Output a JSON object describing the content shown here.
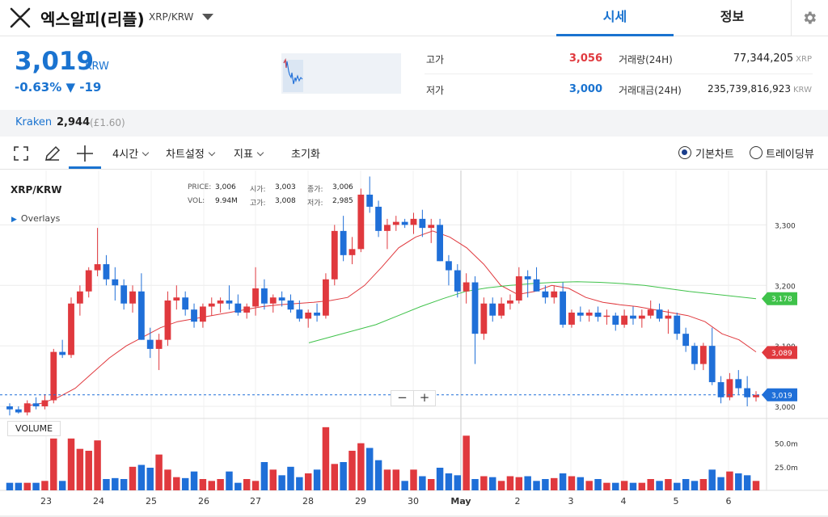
{
  "header": {
    "coin_name": "엑스알피(리플)",
    "pair": "XRP/KRW",
    "tabs": [
      {
        "label": "시세",
        "active": true
      },
      {
        "label": "정보",
        "active": false
      }
    ]
  },
  "price": {
    "current": "3,019",
    "unit": "KRW",
    "change_pct": "-0.63%",
    "change_abs": "▼ -19"
  },
  "stats": {
    "high_label": "고가",
    "high_value": "3,056",
    "low_label": "저가",
    "low_value": "3,000",
    "volume_label": "거래량(24H)",
    "volume_value": "77,344,205",
    "volume_unit": "XRP",
    "amount_label": "거래대금(24H)",
    "amount_value": "235,739,816,923",
    "amount_unit": "KRW"
  },
  "exchange": {
    "name": "Kraken",
    "price": "2,944",
    "sub": "(£1.60)"
  },
  "toolbar": {
    "interval": "4시간",
    "chart_settings": "차트설정",
    "indicators": "지표",
    "reset": "초기화",
    "radio_basic": "기본차트",
    "radio_tradingview": "트레이딩뷰"
  },
  "chart_info": {
    "symbol": "XRP/KRW",
    "overlays": "Overlays",
    "price_k": "PRICE:",
    "price_v": "3,006",
    "vol_k": "VOL:",
    "vol_v": "9.94M",
    "open_k": "시가:",
    "open_v": "3,003",
    "high_k": "고가:",
    "high_v": "3,008",
    "close_k": "종가:",
    "close_v": "3,006",
    "low_k": "저가:",
    "low_v": "2,985",
    "volume_label": "VOLUME",
    "zoom_out": "−",
    "zoom_in": "+"
  },
  "colors": {
    "accent": "#1a73d0",
    "up": "#e0393e",
    "down": "#1f6fd8",
    "ma_short": "#e0393e",
    "ma_long": "#3fc24a"
  },
  "chart_data": {
    "type": "candlestick",
    "price_axis": {
      "ticks": [
        "3,300",
        "3,200",
        "3,100",
        "3,000"
      ],
      "tick_values": [
        3300,
        3200,
        3100,
        3000
      ],
      "range": [
        2980,
        3390
      ]
    },
    "volume_axis": {
      "ticks": [
        "50.0m",
        "25.0m"
      ],
      "tick_values": [
        50,
        25
      ],
      "range": [
        0,
        72
      ]
    },
    "x_labels": [
      "23",
      "24",
      "25",
      "26",
      "27",
      "28",
      "29",
      "30",
      "May",
      "2",
      "3",
      "4",
      "5",
      "6"
    ],
    "last_price_tag": "3,019",
    "ma_tags": [
      "3,178",
      "3,089"
    ],
    "ohlc": [
      [
        3000,
        3005,
        2985,
        2995
      ],
      [
        2995,
        3000,
        2988,
        2990
      ],
      [
        2990,
        3010,
        2985,
        3005
      ],
      [
        3005,
        3015,
        2995,
        3000
      ],
      [
        3000,
        3020,
        2995,
        3010
      ],
      [
        3010,
        3095,
        3005,
        3090
      ],
      [
        3090,
        3110,
        3080,
        3085
      ],
      [
        3085,
        3180,
        3080,
        3170
      ],
      [
        3170,
        3200,
        3150,
        3190
      ],
      [
        3190,
        3230,
        3180,
        3225
      ],
      [
        3225,
        3295,
        3215,
        3235
      ],
      [
        3235,
        3250,
        3200,
        3210
      ],
      [
        3210,
        3230,
        3175,
        3200
      ],
      [
        3200,
        3210,
        3160,
        3170
      ],
      [
        3170,
        3200,
        3155,
        3190
      ],
      [
        3190,
        3220,
        3110,
        3110
      ],
      [
        3110,
        3130,
        3080,
        3095
      ],
      [
        3095,
        3120,
        3060,
        3110
      ],
      [
        3110,
        3190,
        3100,
        3175
      ],
      [
        3175,
        3200,
        3160,
        3180
      ],
      [
        3180,
        3190,
        3150,
        3160
      ],
      [
        3160,
        3170,
        3130,
        3140
      ],
      [
        3140,
        3170,
        3130,
        3165
      ],
      [
        3165,
        3180,
        3150,
        3170
      ],
      [
        3170,
        3180,
        3155,
        3175
      ],
      [
        3175,
        3200,
        3160,
        3170
      ],
      [
        3170,
        3185,
        3150,
        3155
      ],
      [
        3155,
        3170,
        3145,
        3165
      ],
      [
        3165,
        3230,
        3150,
        3195
      ],
      [
        3195,
        3210,
        3160,
        3170
      ],
      [
        3170,
        3185,
        3155,
        3180
      ],
      [
        3180,
        3190,
        3165,
        3175
      ],
      [
        3175,
        3185,
        3155,
        3160
      ],
      [
        3160,
        3175,
        3140,
        3145
      ],
      [
        3145,
        3160,
        3130,
        3155
      ],
      [
        3155,
        3170,
        3140,
        3150
      ],
      [
        3150,
        3220,
        3145,
        3210
      ],
      [
        3210,
        3300,
        3200,
        3290
      ],
      [
        3290,
        3315,
        3240,
        3250
      ],
      [
        3250,
        3280,
        3235,
        3260
      ],
      [
        3260,
        3360,
        3255,
        3350
      ],
      [
        3350,
        3380,
        3320,
        3330
      ],
      [
        3330,
        3340,
        3280,
        3290
      ],
      [
        3290,
        3310,
        3260,
        3300
      ],
      [
        3300,
        3315,
        3290,
        3305
      ],
      [
        3305,
        3310,
        3295,
        3300
      ],
      [
        3300,
        3320,
        3285,
        3310
      ],
      [
        3310,
        3325,
        3280,
        3295
      ],
      [
        3295,
        3310,
        3270,
        3300
      ],
      [
        3300,
        3310,
        3240,
        3240
      ],
      [
        3240,
        3250,
        3200,
        3225
      ],
      [
        3225,
        3235,
        3180,
        3190
      ],
      [
        3190,
        3220,
        3170,
        3205
      ],
      [
        3205,
        3215,
        3070,
        3120
      ],
      [
        3120,
        3180,
        3110,
        3170
      ],
      [
        3170,
        3180,
        3140,
        3150
      ],
      [
        3150,
        3180,
        3145,
        3170
      ],
      [
        3170,
        3185,
        3160,
        3175
      ],
      [
        3175,
        3230,
        3170,
        3215
      ],
      [
        3215,
        3225,
        3180,
        3210
      ],
      [
        3210,
        3230,
        3190,
        3190
      ],
      [
        3190,
        3200,
        3170,
        3180
      ],
      [
        3180,
        3200,
        3170,
        3190
      ],
      [
        3190,
        3205,
        3130,
        3135
      ],
      [
        3135,
        3160,
        3130,
        3155
      ],
      [
        3155,
        3165,
        3140,
        3150
      ],
      [
        3150,
        3160,
        3140,
        3155
      ],
      [
        3155,
        3165,
        3140,
        3148
      ],
      [
        3148,
        3160,
        3135,
        3150
      ],
      [
        3150,
        3155,
        3125,
        3135
      ],
      [
        3135,
        3160,
        3130,
        3150
      ],
      [
        3150,
        3165,
        3135,
        3145
      ],
      [
        3145,
        3160,
        3130,
        3150
      ],
      [
        3150,
        3175,
        3145,
        3160
      ],
      [
        3160,
        3170,
        3140,
        3145
      ],
      [
        3145,
        3160,
        3120,
        3150
      ],
      [
        3150,
        3155,
        3110,
        3120
      ],
      [
        3120,
        3130,
        3090,
        3100
      ],
      [
        3100,
        3105,
        3060,
        3070
      ],
      [
        3070,
        3105,
        3060,
        3100
      ],
      [
        3100,
        3130,
        3035,
        3040
      ],
      [
        3040,
        3050,
        3005,
        3015
      ],
      [
        3015,
        3055,
        3010,
        3045
      ],
      [
        3045,
        3060,
        3020,
        3030
      ],
      [
        3030,
        3050,
        3000,
        3015
      ],
      [
        3015,
        3025,
        3008,
        3019
      ]
    ],
    "volume": [
      8,
      8,
      8,
      8,
      10,
      55,
      10,
      55,
      44,
      42,
      53,
      12,
      13,
      12,
      25,
      27,
      24,
      38,
      22,
      14,
      13,
      20,
      12,
      10,
      12,
      20,
      8,
      12,
      10,
      30,
      22,
      16,
      25,
      14,
      18,
      22,
      67,
      28,
      30,
      42,
      50,
      45,
      32,
      22,
      22,
      10,
      22,
      15,
      12,
      24,
      18,
      16,
      58,
      12,
      15,
      14,
      10,
      15,
      14,
      15,
      10,
      12,
      13,
      18,
      15,
      14,
      10,
      12,
      8,
      8,
      10,
      8,
      8,
      12,
      10,
      12,
      8,
      12,
      10,
      12,
      22,
      14,
      20,
      18,
      16,
      10,
      8,
      15
    ],
    "ma_short": [
      3000,
      3005,
      3015,
      3030,
      3055,
      3080,
      3100,
      3115,
      3130,
      3140,
      3145,
      3150,
      3155,
      3160,
      3165,
      3168,
      3170,
      3172,
      3175,
      3180,
      3200,
      3230,
      3262,
      3280,
      3290,
      3280,
      3262,
      3235,
      3200,
      3185,
      3190,
      3200,
      3195,
      3180,
      3172,
      3168,
      3165,
      3160,
      3155,
      3150,
      3140,
      3120,
      3110,
      3090
    ],
    "ma_long": [
      3105,
      3115,
      3125,
      3135,
      3150,
      3165,
      3178,
      3190,
      3196,
      3200,
      3203,
      3205,
      3206,
      3205,
      3203,
      3200,
      3195,
      3190,
      3186,
      3182,
      3178
    ]
  }
}
